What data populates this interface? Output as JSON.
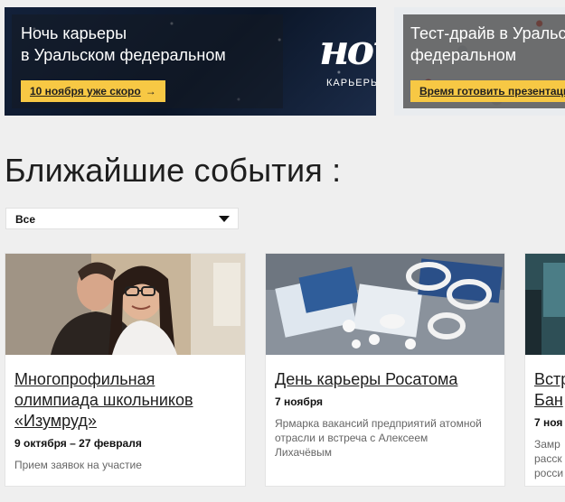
{
  "banners": [
    {
      "title_line1": "Ночь карьеры",
      "title_line2": "в Уральском федеральном",
      "cta": "10 ноября уже скоро",
      "cta_arrow": "→",
      "logo_script": "ночь",
      "logo_sub": "КАРЬЕРЫ"
    },
    {
      "title_line1": "Тест-драйв в Уральском",
      "title_line2": "федеральном",
      "cta": "Время готовить презентации",
      "cta_arrow": "→"
    }
  ],
  "events": {
    "title": "Ближайшие события :",
    "filter": {
      "selected": "Все"
    },
    "cards": [
      {
        "title_lines": [
          "Многопрофильная",
          "олимпиада школьников",
          "«Изумруд»"
        ],
        "date": "9 октября – 27 февраля",
        "description_lines": [
          "Прием заявок на участие"
        ]
      },
      {
        "title_lines": [
          "День карьеры Росатома"
        ],
        "date": "7 ноября",
        "description_lines": [
          "Ярмарка вакансий предприятий атомной",
          "отрасли и встреча с Алексеем",
          "Лихачёвым"
        ]
      },
      {
        "title_lines": [
          "Встр",
          "Бан"
        ],
        "date": "7 ноя",
        "description_lines": [
          "Замр",
          "расск",
          "росси"
        ]
      }
    ]
  },
  "colors": {
    "accent": "#f7c844",
    "page_bg": "#efefef",
    "banner_dark": "#0e1a2e"
  }
}
